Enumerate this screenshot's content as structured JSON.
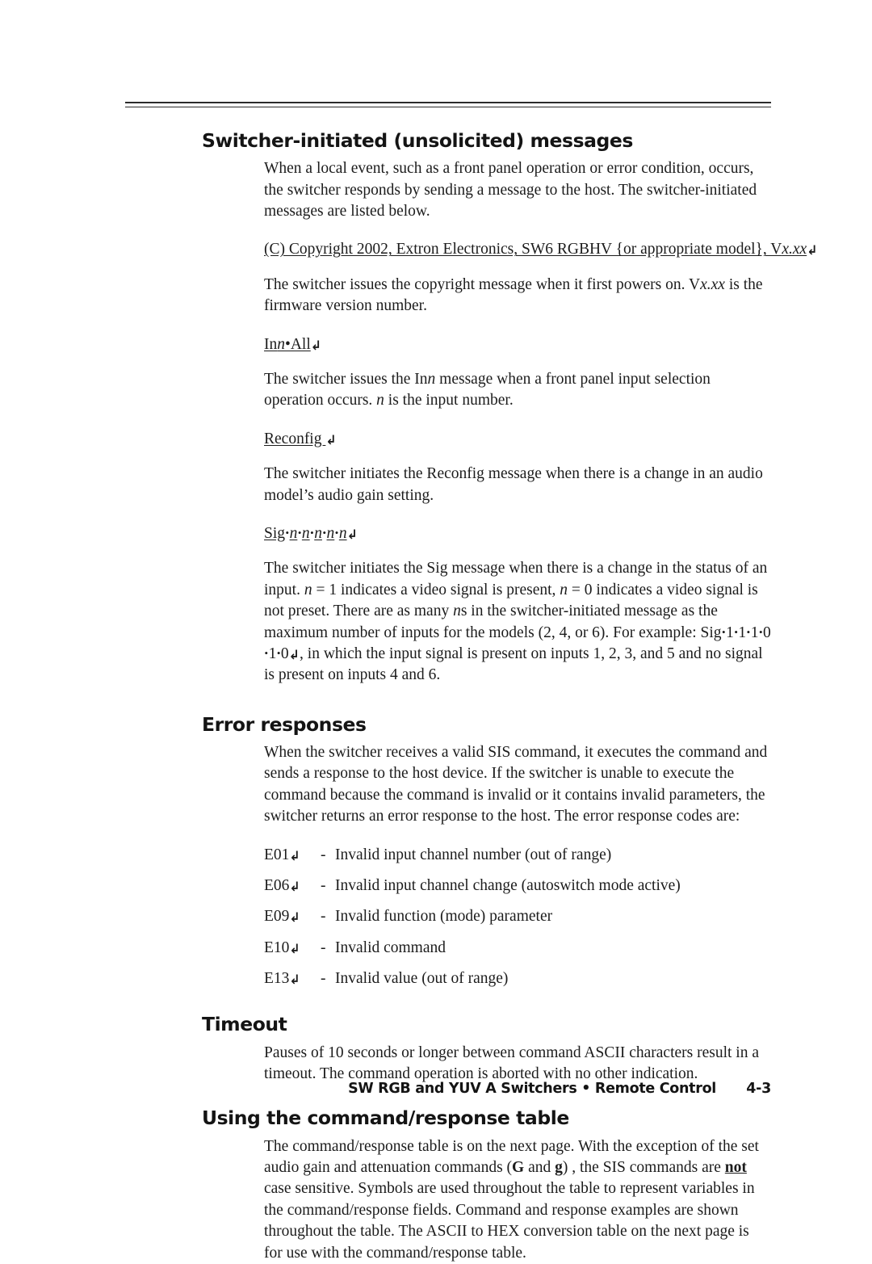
{
  "document": {
    "footer_title": "SW RGB and YUV A Switchers • Remote Control",
    "page_number": "4-3"
  },
  "sections": [
    {
      "heading": "Switcher-initiated (unsolicited) messages",
      "intro": "When a local event, such as a front panel operation or error condition, occurs, the switcher responds by sending a message to the host.  The switcher-initiated messages are listed below.",
      "items": [
        {
          "command_prefix": "(C) Copyright 2002, Extron Electronics, SW6 RGBHV {or appropriate model}, V",
          "command_italic": "x.xx",
          "command_suffix": "",
          "return_symbol": "↲",
          "description_a": "The switcher issues the copyright message when it first powers on.  V",
          "description_italic": "x.xx",
          "description_b": " is the firmware version number."
        },
        {
          "command_prefix": "In",
          "command_italic": "n",
          "command_suffix": "•All",
          "return_symbol": "↲",
          "description_a": "The switcher issues the In",
          "description_italic": "n",
          "description_b": " message when a front panel input selection operation occurs.  ",
          "description_italic2": "n",
          "description_c": " is the input number."
        },
        {
          "command_prefix": "Reconfig ",
          "command_italic": "",
          "command_suffix": "",
          "return_symbol": "↲",
          "description_a": "The switcher initiates the Reconfig message when there is a change in an audio model’s audio gain setting."
        },
        {
          "command_prefix": "Sig",
          "command_italic": "",
          "command_suffix": "",
          "return_symbol": "↲",
          "sig_pattern_bullets": "•",
          "sig_pattern_var": "n",
          "sig_var_count": 5,
          "description_full_a": "The switcher initiates the Sig message when there is a change in the status of an input.  ",
          "description_var1": "n",
          "description_full_b": " = 1 indicates a video signal is present, ",
          "description_var2": "n",
          "description_full_c": " = 0 indicates a video signal is not preset.  There are as many ",
          "description_var3": "n",
          "description_full_d": "s in the switcher-initiated message as the maximum number of inputs for the models (2, 4, or 6).  For example: Sig",
          "example_tokens": [
            "1",
            "1",
            "1",
            "0",
            "1",
            "0"
          ],
          "description_full_e": ", in which the input signal is present on inputs 1, 2, 3, and 5 and no signal is present on inputs 4 and 6."
        }
      ]
    },
    {
      "heading": "Error responses",
      "intro": "When the switcher receives a valid SIS command, it executes the command and sends a response to the host device.  If the switcher is unable to execute the command because the command is invalid or it contains invalid parameters, the switcher returns an error response to the host.  The error response codes are:",
      "error_codes": [
        {
          "code": "E01",
          "return_symbol": "↲",
          "dash": "-",
          "description": "Invalid input channel number (out of range)"
        },
        {
          "code": "E06",
          "return_symbol": "↲",
          "dash": "-",
          "description": "Invalid input channel change (autoswitch mode active)"
        },
        {
          "code": "E09",
          "return_symbol": "↲",
          "dash": "-",
          "description": "Invalid function (mode) parameter"
        },
        {
          "code": "E10",
          "return_symbol": "↲",
          "dash": "-",
          "description": "Invalid command"
        },
        {
          "code": "E13",
          "return_symbol": "↲",
          "dash": "-",
          "description": "Invalid value (out of range)"
        }
      ]
    },
    {
      "heading": "Timeout",
      "intro": "Pauses of 10 seconds or longer between command ASCII characters result in a timeout.  The command operation is aborted with no other indication."
    },
    {
      "heading": "Using the command/response table",
      "para_a": "The command/response table is on the next page.  With the exception of the set audio gain and attenuation commands (",
      "bold_G": "G",
      "para_b": " and ",
      "bold_g": "g",
      "para_c": ") , the SIS commands are ",
      "bold_not": "not",
      "para_d": " case sensitive.  Symbols are used throughout the table to represent variables in the command/response fields.  Command and response examples are shown throughout the table.  The ASCII to HEX conversion table on the next page is for use with the command/response table."
    }
  ]
}
